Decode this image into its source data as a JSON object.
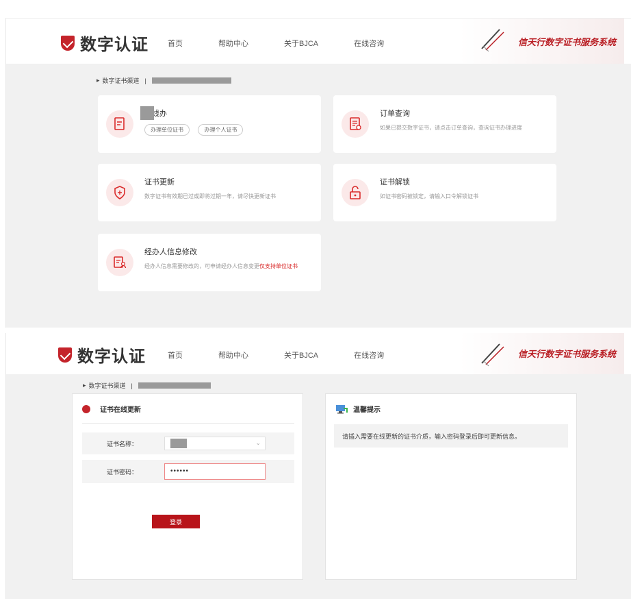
{
  "header": {
    "logo_text": "数字认证",
    "nav": [
      "首页",
      "帮助中心",
      "关于BJCA",
      "在线咨询"
    ],
    "banner_text": "信天行数字证书服务系统"
  },
  "top": {
    "breadcrumb": "数字证书渠道",
    "cards": [
      {
        "title": "在线办",
        "desc": "",
        "pills": [
          "办理单位证书",
          "办理个人证书"
        ]
      },
      {
        "title": "订单查询",
        "desc": "如果已提交数字证书，请点击订单查询，查询证书办理进度"
      },
      {
        "title": "证书更新",
        "desc": "数字证书有效期已过或即将过期一年，请尽快更新证书"
      },
      {
        "title": "证书解锁",
        "desc": "如证书密码被锁定，请输入口令解锁证书"
      },
      {
        "title": "经办人信息修改",
        "desc_prefix": "经办人信息需要修改的，可申请经办人信息变更",
        "desc_link": "仅支持单位证书"
      }
    ]
  },
  "bottom": {
    "breadcrumb": "数字证书渠道",
    "form": {
      "title": "证书在线更新",
      "name_label": "证书名称：",
      "password_label": "证书密码：",
      "password_value": "••••••",
      "submit_label": "登录"
    },
    "tip": {
      "title": "温馨提示",
      "text": "请插入需要在线更新的证书介质，输入密码登录后即可更新信息。"
    }
  }
}
